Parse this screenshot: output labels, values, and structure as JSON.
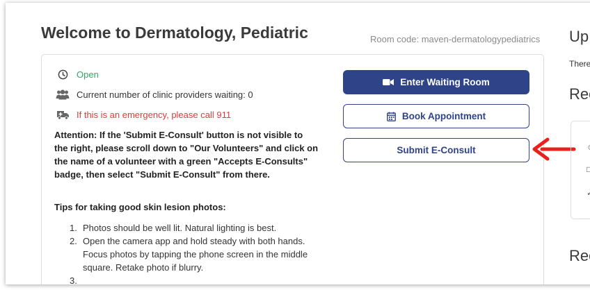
{
  "header": {
    "title": "Welcome to Dermatology, Pediatric",
    "room_code": "Room code: maven-dermatologypediatrics"
  },
  "status": {
    "open": "Open",
    "providers_waiting": "Current number of clinic providers waiting: 0",
    "emergency": "If this is an emergency, please call 911"
  },
  "attention": "Attention: If the 'Submit E-Consult' button is not visible to the right, please scroll down to \"Our Volunteers\" and click on the name of a volunteer with a green \"Accepts E-Consults\" badge, then select \"Submit E-Consult\" from there.",
  "tips": {
    "title": "Tips for taking good skin lesion photos:",
    "items": [
      {
        "num": "1.",
        "text": "Photos should be well lit. Natural lighting is best."
      },
      {
        "num": "2.",
        "text": "Open the camera app and hold steady with both hands. Focus photos by tapping the phone screen in the middle square. Retake photo if blurry."
      },
      {
        "num": "3.",
        "text": ""
      }
    ]
  },
  "buttons": {
    "enter_waiting_room": "Enter Waiting Room",
    "book_appointment": "Book Appointment",
    "submit_econsult": "Submit E-Consult"
  },
  "right_panel": {
    "heading": "Up",
    "text": "There",
    "subheading_1": "Rec",
    "subheading_2": "Rec"
  },
  "colors": {
    "primary": "#2f4388",
    "open_green": "#2eaa61",
    "emergency_red": "#e03b3b",
    "arrow_red": "#e8211d"
  },
  "icons": {
    "open": "clock-icon",
    "providers": "users-icon",
    "emergency": "ambulance-icon",
    "enter": "video-camera-icon",
    "book": "calendar-icon"
  }
}
